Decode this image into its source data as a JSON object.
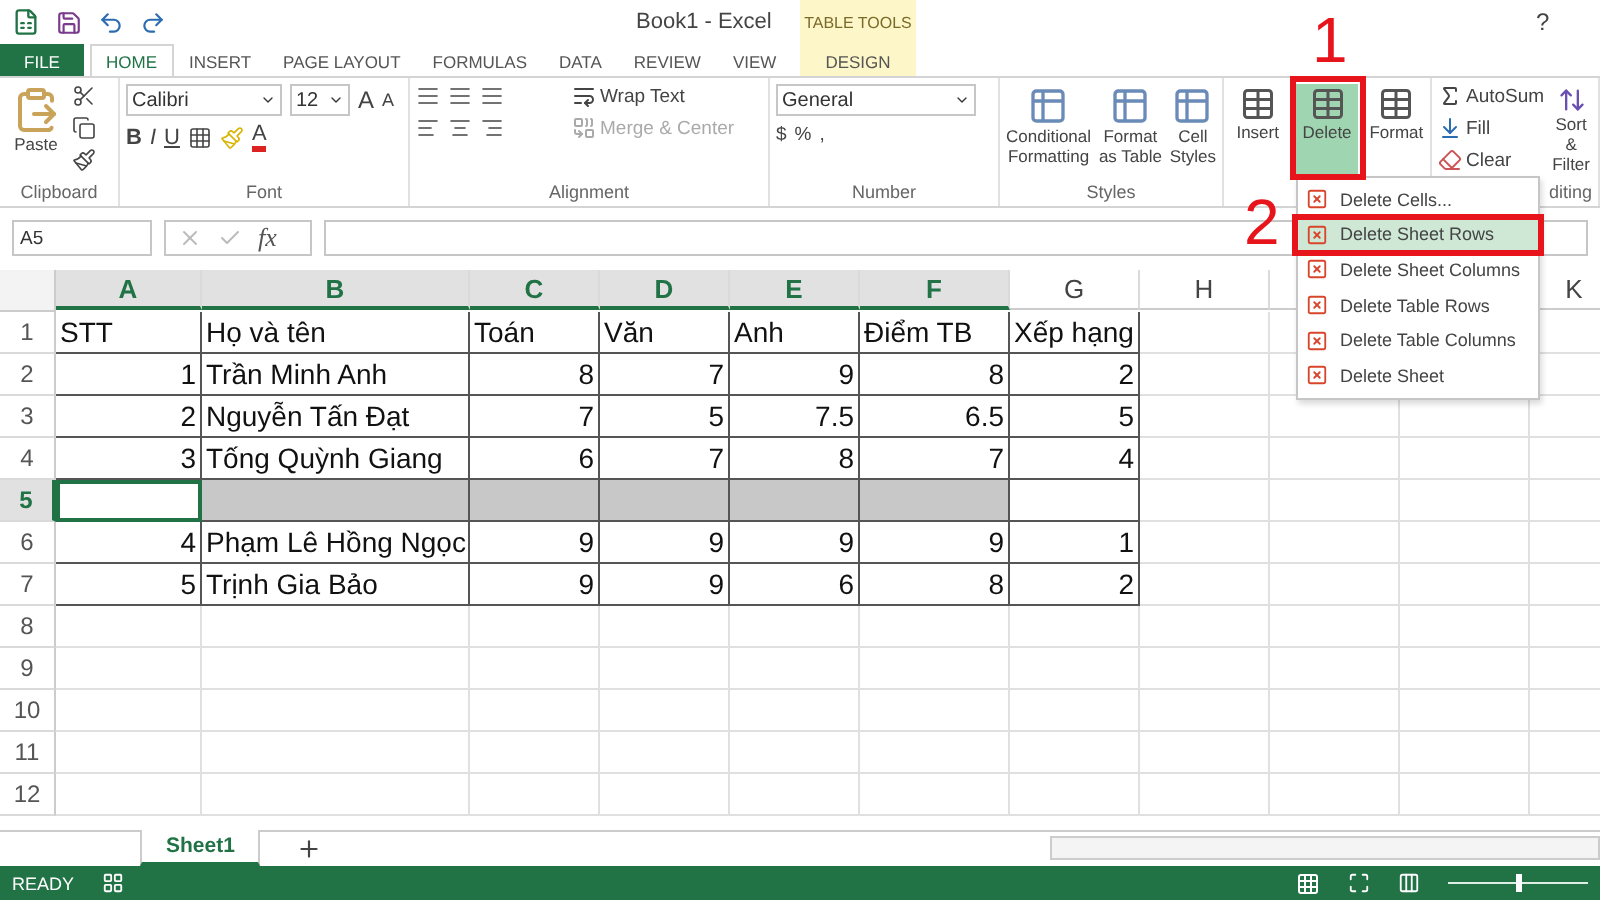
{
  "window": {
    "title": "Book1 - Excel",
    "help": "?"
  },
  "context_tab_group": {
    "label": "TABLE TOOLS"
  },
  "tabs": [
    {
      "label": "FILE",
      "kind": "file",
      "selected": false
    },
    {
      "label": "HOME",
      "kind": "normal",
      "selected": true
    },
    {
      "label": "INSERT",
      "kind": "normal",
      "selected": false
    },
    {
      "label": "PAGE LAYOUT",
      "kind": "normal",
      "selected": false
    },
    {
      "label": "FORMULAS",
      "kind": "normal",
      "selected": false
    },
    {
      "label": "DATA",
      "kind": "normal",
      "selected": false
    },
    {
      "label": "REVIEW",
      "kind": "normal",
      "selected": false
    },
    {
      "label": "VIEW",
      "kind": "normal",
      "selected": false
    },
    {
      "label": "DESIGN",
      "kind": "context",
      "selected": false
    }
  ],
  "ribbon": {
    "clipboard": {
      "paste": "Paste",
      "label": "Clipboard"
    },
    "font": {
      "name": "Calibri",
      "size": "12",
      "bold": "B",
      "italic": "I",
      "underline": "U",
      "grow": "A",
      "shrink": "A",
      "font_color_button": "A",
      "label": "Font"
    },
    "alignment": {
      "wrap": "Wrap Text",
      "merge": "Merge & Center",
      "merge_disabled": true,
      "label": "Alignment"
    },
    "number": {
      "format": "General",
      "currency": "$",
      "percent": "%",
      "comma": ",",
      "label": "Number"
    },
    "styles": {
      "buttons": [
        "Conditional Formatting",
        "Format as Table",
        "Cell Styles"
      ],
      "label": "Styles"
    },
    "cells": {
      "buttons": [
        {
          "label": "Insert",
          "selected": false
        },
        {
          "label": "Delete",
          "selected": true
        },
        {
          "label": "Format",
          "selected": false
        }
      ]
    },
    "editing": {
      "autosum": "AutoSum",
      "fill": "Fill",
      "clear": "Clear",
      "sort": "Sort & Filter",
      "label": "diting"
    }
  },
  "formula_bar": {
    "name_box": "A5",
    "function_label": "fx"
  },
  "sheet": {
    "columns": [
      {
        "letter": "A",
        "selected": true
      },
      {
        "letter": "B",
        "selected": true
      },
      {
        "letter": "C",
        "selected": true
      },
      {
        "letter": "D",
        "selected": true
      },
      {
        "letter": "E",
        "selected": true
      },
      {
        "letter": "F",
        "selected": true
      },
      {
        "letter": "G",
        "selected": false
      },
      {
        "letter": "H",
        "selected": false
      },
      {
        "letter": "K",
        "selected": false
      }
    ],
    "rows": [
      {
        "number": "1",
        "kind": "header",
        "selected": false,
        "cells": [
          "STT",
          "Họ và tên",
          "Toán",
          "Văn",
          "Anh",
          "Điểm TB",
          "Xếp hạng"
        ]
      },
      {
        "number": "2",
        "kind": "data",
        "selected": false,
        "cells": [
          "1",
          "Trần Minh Anh",
          "8",
          "7",
          "9",
          "8",
          "2"
        ]
      },
      {
        "number": "3",
        "kind": "data",
        "selected": false,
        "cells": [
          "2",
          "Nguyễn Tấn Đạt",
          "7",
          "5",
          "7.5",
          "6.5",
          "5"
        ]
      },
      {
        "number": "4",
        "kind": "data",
        "selected": false,
        "cells": [
          "3",
          "Tống Quỳnh Giang",
          "6",
          "7",
          "8",
          "7",
          "4"
        ]
      },
      {
        "number": "5",
        "kind": "data",
        "selected": true,
        "cells": []
      },
      {
        "number": "6",
        "kind": "data",
        "selected": false,
        "cells": [
          "4",
          "Phạm Lê Hồng Ngọc",
          "9",
          "9",
          "9",
          "9",
          "1"
        ]
      },
      {
        "number": "7",
        "kind": "data",
        "selected": false,
        "cells": [
          "5",
          "Trịnh Gia Bảo",
          "9",
          "9",
          "6",
          "8",
          "2"
        ]
      },
      {
        "number": "8",
        "kind": "empty",
        "selected": false
      },
      {
        "number": "9",
        "kind": "empty",
        "selected": false
      },
      {
        "number": "10",
        "kind": "empty",
        "selected": false
      },
      {
        "number": "11",
        "kind": "empty",
        "selected": false
      },
      {
        "number": "12",
        "kind": "empty",
        "selected": false
      }
    ]
  },
  "context_menu": {
    "items": [
      {
        "label": "Delete Cells...",
        "selected": false
      },
      {
        "label": "Delete Sheet Rows",
        "selected": true
      },
      {
        "label": "Delete Sheet Columns",
        "selected": false
      },
      {
        "label": "Delete Table Rows",
        "selected": false
      },
      {
        "label": "Delete Table Columns",
        "selected": false
      },
      {
        "label": "Delete Sheet",
        "selected": false
      }
    ]
  },
  "annotations": [
    {
      "label": "1"
    },
    {
      "label": "2"
    }
  ],
  "sheet_tabs": [
    {
      "label": "Sheet1",
      "selected": true
    }
  ],
  "status_bar": {
    "status": "READY",
    "zoom_slider": {
      "level": 0.5
    }
  }
}
